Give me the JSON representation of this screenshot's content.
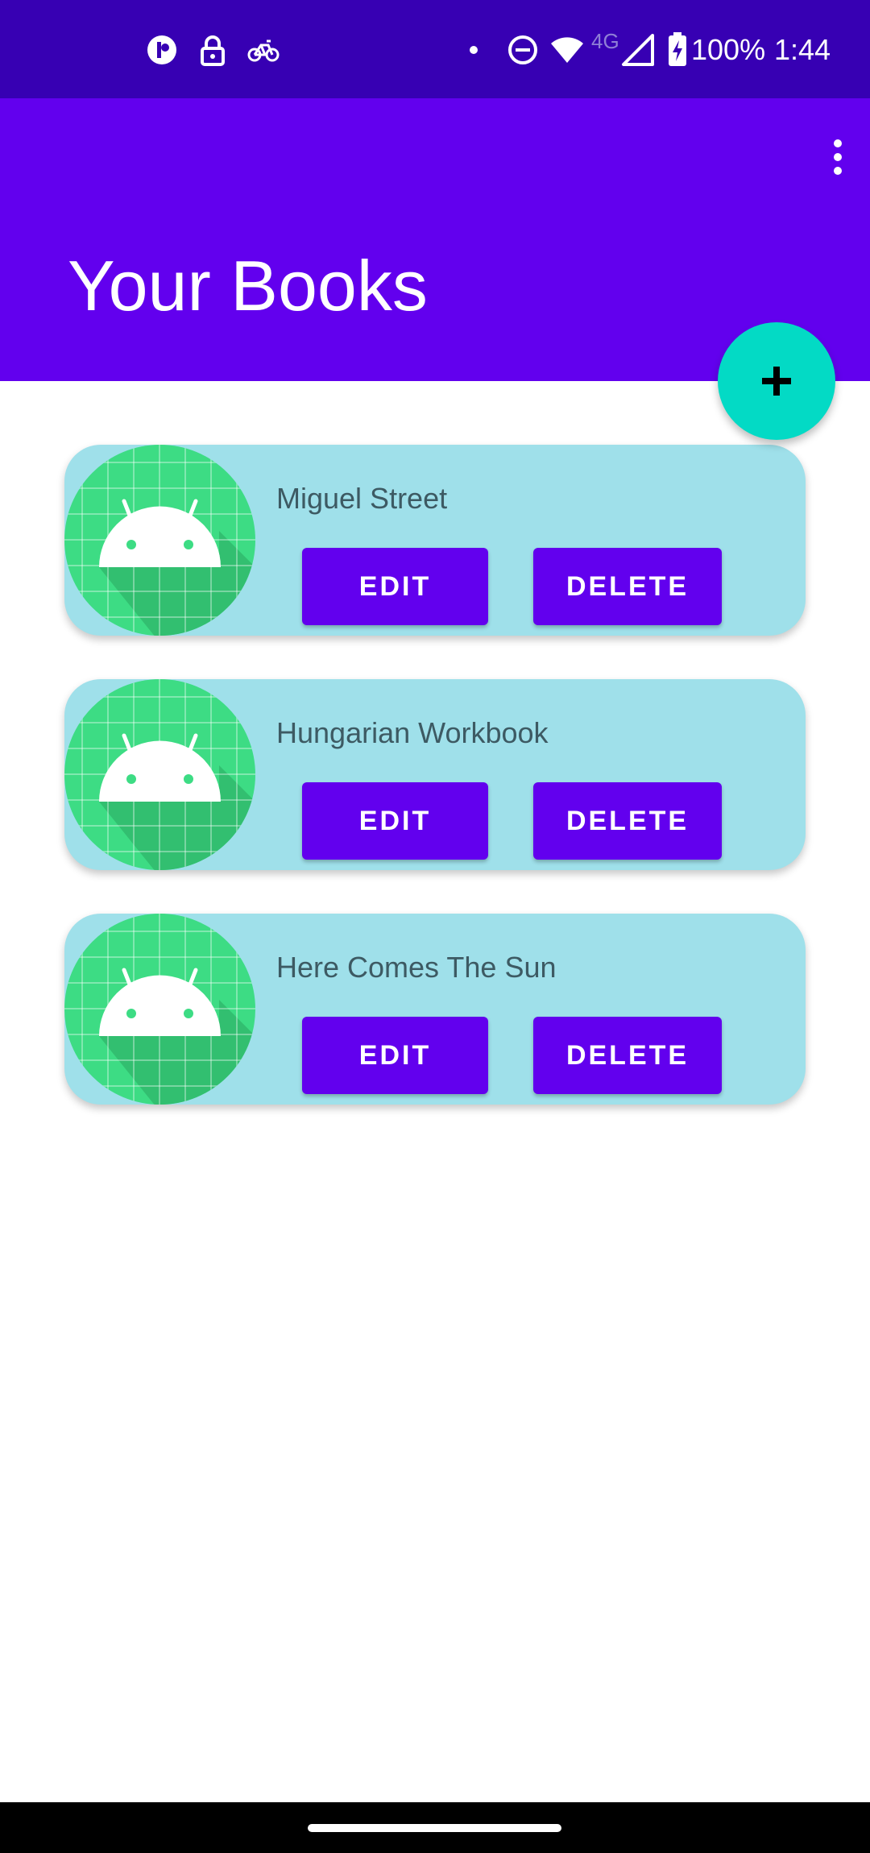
{
  "status_bar": {
    "battery": "100%",
    "time": "1:44",
    "network_type": "4G",
    "icons": [
      "status-app-icon",
      "lock-icon",
      "bike-icon",
      "notification-dot-icon",
      "do-not-disturb-icon",
      "wifi-icon",
      "signal-icon",
      "battery-charging-icon"
    ]
  },
  "app_bar": {
    "title": "Your Books",
    "menu_icon": "more-vert-icon"
  },
  "fab": {
    "icon": "add-icon"
  },
  "books": [
    {
      "title": "Miguel Street",
      "edit_label": "EDIT",
      "delete_label": "DELETE"
    },
    {
      "title": "Hungarian Workbook",
      "edit_label": "EDIT",
      "delete_label": "DELETE"
    },
    {
      "title": "Here Comes The Sun",
      "edit_label": "EDIT",
      "delete_label": "DELETE"
    }
  ],
  "colors": {
    "status_bar": "#3700b3",
    "primary": "#6200ee",
    "accent": "#03dac5",
    "card_background": "#9fe0ea",
    "android_green": "#3ddc84"
  }
}
